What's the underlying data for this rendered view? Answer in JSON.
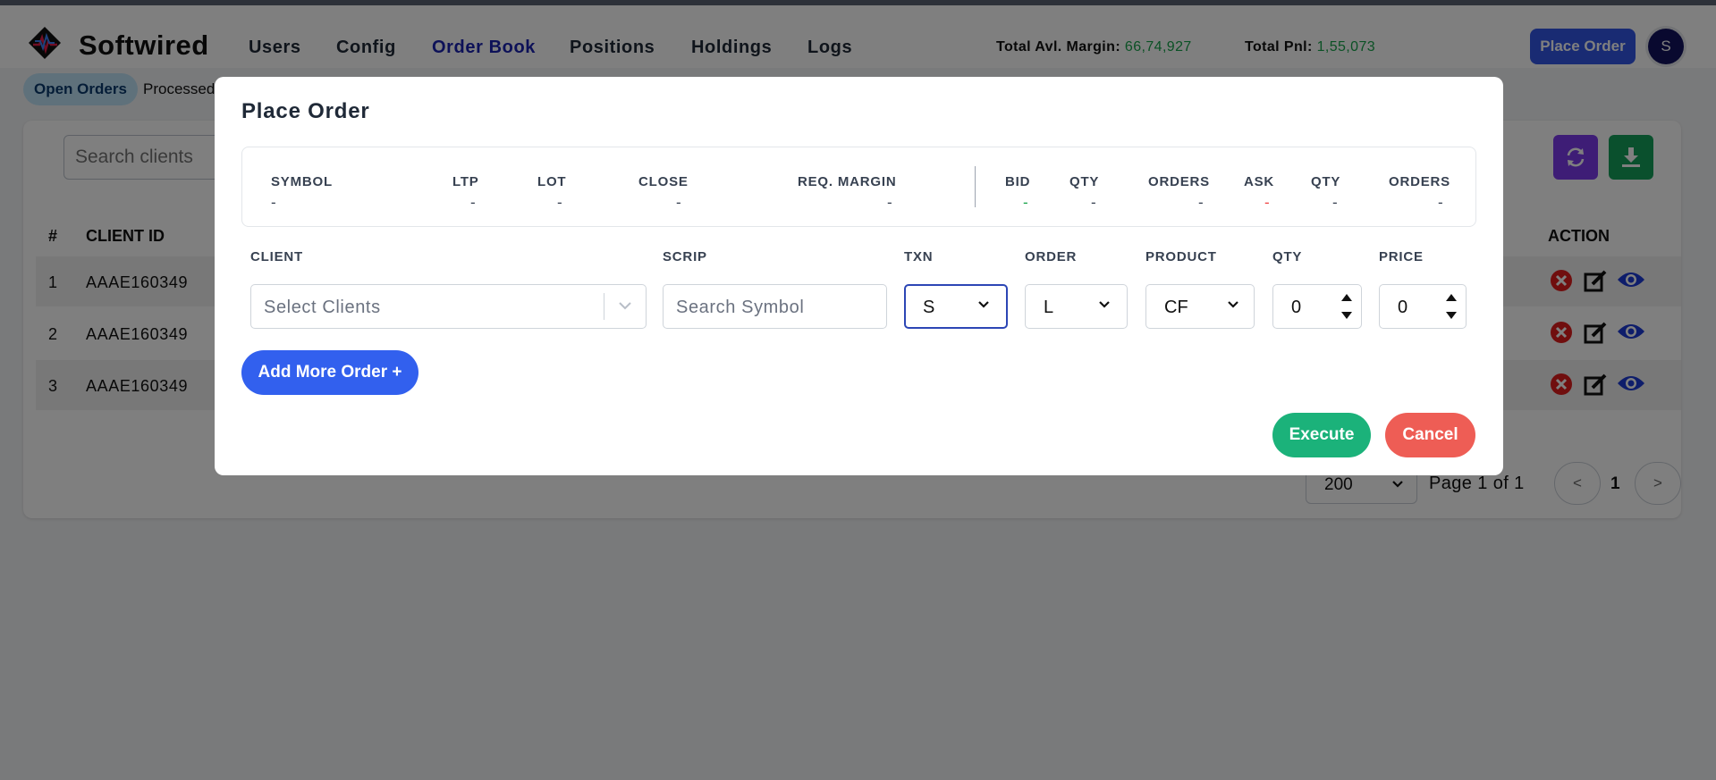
{
  "app": {
    "brand": "Softwired",
    "nav": [
      "Users",
      "Config",
      "Order Book",
      "Positions",
      "Holdings",
      "Logs"
    ],
    "active_nav": "Order Book",
    "stats": {
      "margin_label": "Total Avl. Margin:",
      "margin_value": "66,74,927",
      "pnl_label": "Total Pnl:",
      "pnl_value": "1,55,073"
    },
    "place_order_button": "Place Order",
    "avatar_initial": "S"
  },
  "subtabs": [
    "Open Orders",
    "Processed"
  ],
  "toolbar": {
    "search_placeholder": "Search clients"
  },
  "table": {
    "headers": {
      "index": "#",
      "client_id": "CLIENT ID",
      "action": "ACTION"
    },
    "rows": [
      {
        "index": "1",
        "client_id": "AAAE160349"
      },
      {
        "index": "2",
        "client_id": "AAAE160349"
      },
      {
        "index": "3",
        "client_id": "AAAE160349"
      }
    ]
  },
  "pagination": {
    "page_size": "200",
    "page_text": "Page 1 of 1",
    "prev": "<",
    "current": "1",
    "next": ">"
  },
  "modal": {
    "title": "Place Order",
    "quote": {
      "symbol_label": "SYMBOL",
      "symbol_value": "-",
      "ltp_label": "LTP",
      "ltp_value": "-",
      "lot_label": "LOT",
      "lot_value": "-",
      "close_label": "CLOSE",
      "close_value": "-",
      "req_margin_label": "REQ. MARGIN",
      "req_margin_value": "-",
      "bid_label": "BID",
      "bid_value": "-",
      "bid_qty_label": "QTY",
      "bid_qty_value": "-",
      "bid_orders_label": "ORDERS",
      "bid_orders_value": "-",
      "ask_label": "ASK",
      "ask_value": "-",
      "ask_qty_label": "QTY",
      "ask_qty_value": "-",
      "ask_orders_label": "ORDERS",
      "ask_orders_value": "-"
    },
    "form": {
      "client_label": "CLIENT",
      "client_placeholder": "Select Clients",
      "scrip_label": "SCRIP",
      "scrip_placeholder": "Search Symbol",
      "txn_label": "TXN",
      "txn_value": "S",
      "order_label": "ORDER",
      "order_value": "L",
      "product_label": "PRODUCT",
      "product_value": "CF",
      "qty_label": "QTY",
      "qty_value": "0",
      "price_label": "PRICE",
      "price_value": "0"
    },
    "add_more_button": "Add More Order +",
    "execute_button": "Execute",
    "cancel_button": "Cancel"
  },
  "colors": {
    "brand_blue": "#3256e6",
    "positive_green": "#17a34a",
    "execute_green": "#1bb27a",
    "cancel_red": "#ee5d55",
    "nav_active": "#1a22b0"
  }
}
